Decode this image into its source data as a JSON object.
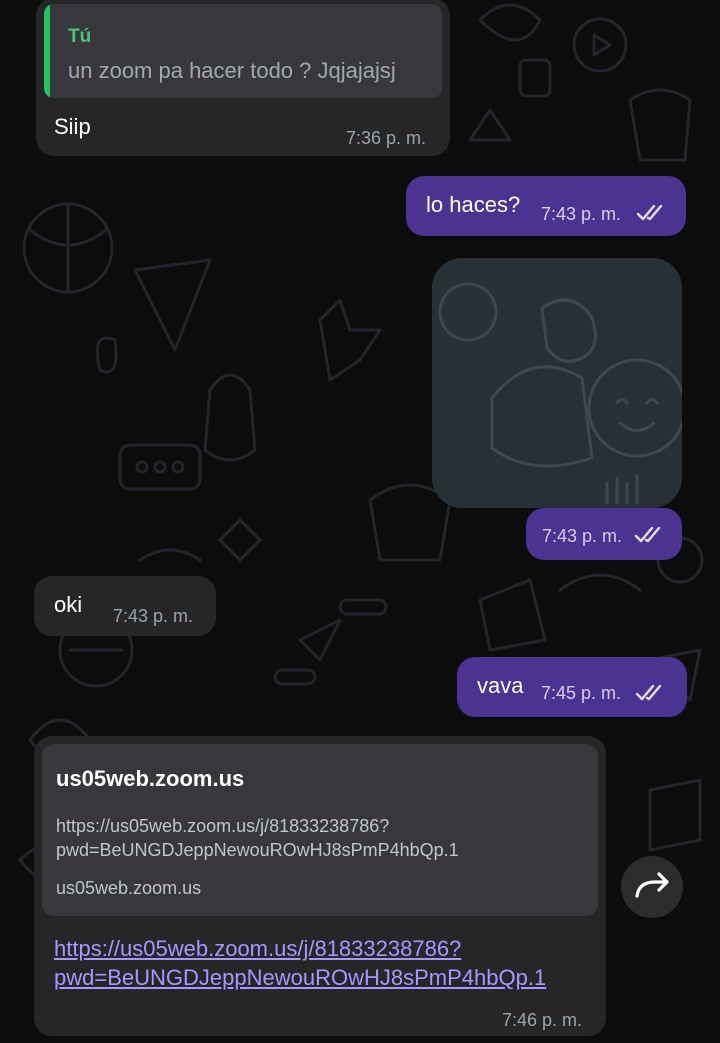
{
  "colors": {
    "incoming": "#242628",
    "outgoing": "#4b3391",
    "quote_bar": "#22c55e",
    "link": "#a996ff"
  },
  "messages": {
    "reply": {
      "quote_author": "Tú",
      "quote_text": "un zoom pa hacer todo ? Jqjajajsj",
      "text": "Siip",
      "time": "7:36 p. m."
    },
    "lo_haces": {
      "text": "lo haces?",
      "time": "7:43 p. m."
    },
    "sticker": {
      "time": "7:43 p. m."
    },
    "oki": {
      "text": "oki",
      "time": "7:43 p. m."
    },
    "vava": {
      "text": "vava",
      "time": "7:45 p. m."
    },
    "link_msg": {
      "preview_title": "us05web.zoom.us",
      "preview_desc": "https://us05web.zoom.us/j/81833238786?pwd=BeUNGDJeppNewouROwHJ8sPmP4hbQp.1",
      "preview_domain": "us05web.zoom.us",
      "link": "https://us05web.zoom.us/j/81833238786?pwd=BeUNGDJeppNewouROwHJ8sPmP4hbQp.1",
      "time": "7:46 p. m."
    }
  },
  "icons": {
    "read_receipt": "double-check-icon",
    "forward": "forward-arrow-icon"
  }
}
